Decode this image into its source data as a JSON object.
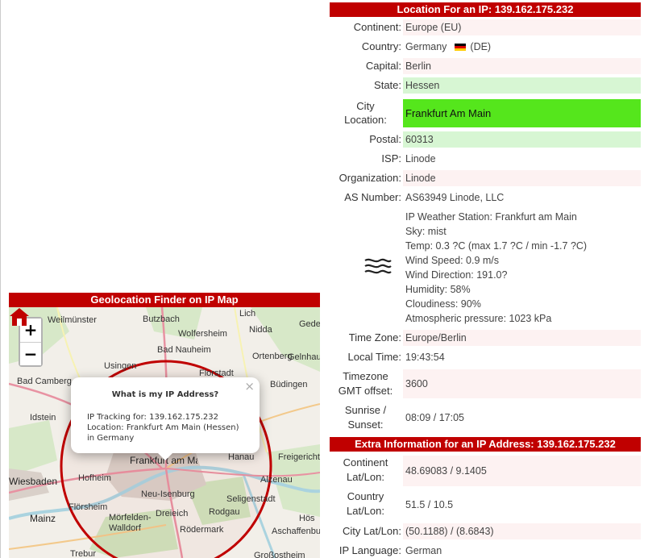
{
  "map": {
    "header": "Geolocation Finder on IP Map",
    "zoom_in": "+",
    "zoom_out": "−",
    "places": [
      "Weilmünster",
      "Butzbach",
      "Lich",
      "Gede",
      "Wolfersheim",
      "Nidda",
      "Bad Nauheim",
      "Ortenberg",
      "Gelnhau",
      "Usingen",
      "Florstadt",
      "Bad Camberg",
      "Büdingen",
      "Idstein",
      "Hanau",
      "Freigericht",
      "Hofheim",
      "Frankfurt am Main",
      "Wiesbaden",
      "Alzenau",
      "Neu-Isenburg",
      "Seligenstadt",
      "Mainz",
      "Flörsheim",
      "Mörfelden-Walldorf",
      "Dreieich",
      "Rodgau",
      "Hös",
      "Rödermark",
      "Aschaffenbu",
      "Trebur",
      "Großostheim"
    ],
    "popup": {
      "title": "What is my IP Address?",
      "close": "×",
      "tracking": "IP Tracking for: 139.162.175.232",
      "location": "Location: Frankfurt Am Main (Hessen)",
      "country": "in Germany"
    }
  },
  "location": {
    "header": "Location For an IP: 139.162.175.232",
    "continent_label": "Continent:",
    "continent": "Europe (EU)",
    "country_label": "Country:",
    "country": "Germany",
    "country_code": "(DE)",
    "capital_label": "Capital:",
    "capital": "Berlin",
    "state_label": "State:",
    "state": "Hessen",
    "city_label_1": "City",
    "city_label_2": "Location:",
    "city": "Frankfurt Am Main",
    "postal_label": "Postal:",
    "postal": "60313",
    "isp_label": "ISP:",
    "isp": "Linode",
    "org_label": "Organization:",
    "org": "Linode",
    "as_label": "AS Number:",
    "as_number": "AS63949 Linode, LLC",
    "weather": {
      "station": "IP Weather Station: Frankfurt am Main",
      "sky": "Sky: mist",
      "temp": "Temp: 0.3 ?C (max 1.7 ?C / min -1.7 ?C)",
      "wind_speed": "Wind Speed: 0.9 m/s",
      "wind_dir": "Wind Direction: 191.0?",
      "humidity": "Humidity: 58%",
      "cloudiness": "Cloudiness: 90%",
      "pressure": "Atmospheric pressure: 1023 kPa"
    },
    "tz_label": "Time Zone:",
    "tz": "Europe/Berlin",
    "lt_label": "Local Time:",
    "local_time": "19:43:54",
    "gmt_label_1": "Timezone",
    "gmt_label_2": "GMT offset:",
    "gmt_offset": "3600",
    "sun_label_1": "Sunrise /",
    "sun_label_2": "Sunset:",
    "sun": "08:09 / 17:05"
  },
  "extra": {
    "header": "Extra Information for an IP Address: 139.162.175.232",
    "cont_ll_label_1": "Continent",
    "cont_ll_label_2": "Lat/Lon:",
    "cont_ll": "48.69083 / 9.1405",
    "ctry_ll_label_1": "Country",
    "ctry_ll_label_2": "Lat/Lon:",
    "ctry_ll": "51.5 / 10.5",
    "city_ll_label": "City Lat/Lon:",
    "city_ll": "(50.1188) / (8.6843)",
    "lang_label": "IP Language:",
    "lang": "German"
  },
  "colors": {
    "header_red": "#c00000",
    "city_green": "#55e61c",
    "light_green": "#d7f6d3",
    "light_pink": "#fdf2f2"
  }
}
